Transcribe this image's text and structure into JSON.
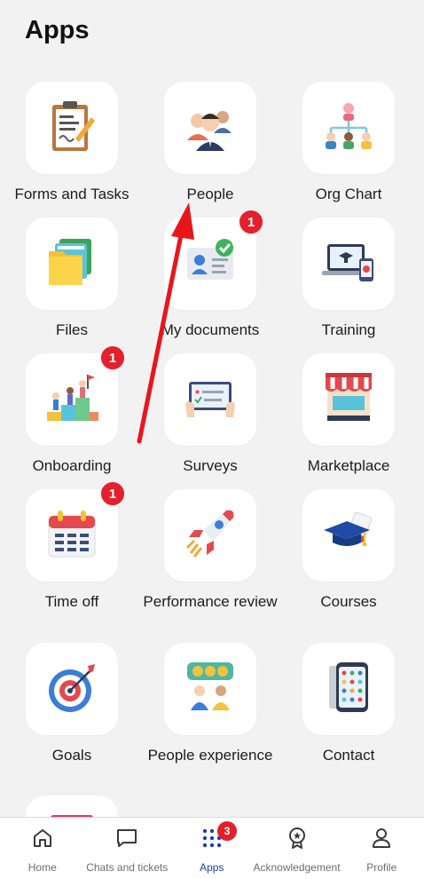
{
  "header": {
    "title": "Apps"
  },
  "apps": [
    {
      "label": "Forms and Tasks",
      "icon": "clipboard-icon"
    },
    {
      "label": "People",
      "icon": "people-icon"
    },
    {
      "label": "Org Chart",
      "icon": "org-chart-icon"
    },
    {
      "label": "Files",
      "icon": "folder-icon"
    },
    {
      "label": "My documents",
      "icon": "id-card-icon",
      "badge": "1"
    },
    {
      "label": "Training",
      "icon": "laptop-training-icon"
    },
    {
      "label": "Onboarding",
      "icon": "climbing-steps-icon",
      "badge": "1"
    },
    {
      "label": "Surveys",
      "icon": "tablet-survey-icon"
    },
    {
      "label": "Marketplace",
      "icon": "storefront-icon"
    },
    {
      "label": "Time off",
      "icon": "calendar-icon",
      "badge": "1"
    },
    {
      "label": "Performance review",
      "icon": "rocket-icon"
    },
    {
      "label": "Courses",
      "icon": "graduation-cap-icon"
    },
    {
      "label": "Goals",
      "icon": "target-icon"
    },
    {
      "label": "People experience",
      "icon": "feedback-faces-icon"
    },
    {
      "label": "Contact",
      "icon": "phone-contacts-icon"
    }
  ],
  "tabbar": {
    "items": [
      {
        "label": "Home",
        "icon": "home-icon"
      },
      {
        "label": "Chats and tickets",
        "icon": "chat-icon"
      },
      {
        "label": "Apps",
        "icon": "apps-grid-icon",
        "badge": "3",
        "active": true
      },
      {
        "label": "Acknowledgement",
        "icon": "award-icon"
      },
      {
        "label": "Profile",
        "icon": "person-icon"
      }
    ]
  },
  "colors": {
    "accent": "#1e3fa8",
    "badge": "#e3202b",
    "annotation_arrow": "#e8161b"
  }
}
